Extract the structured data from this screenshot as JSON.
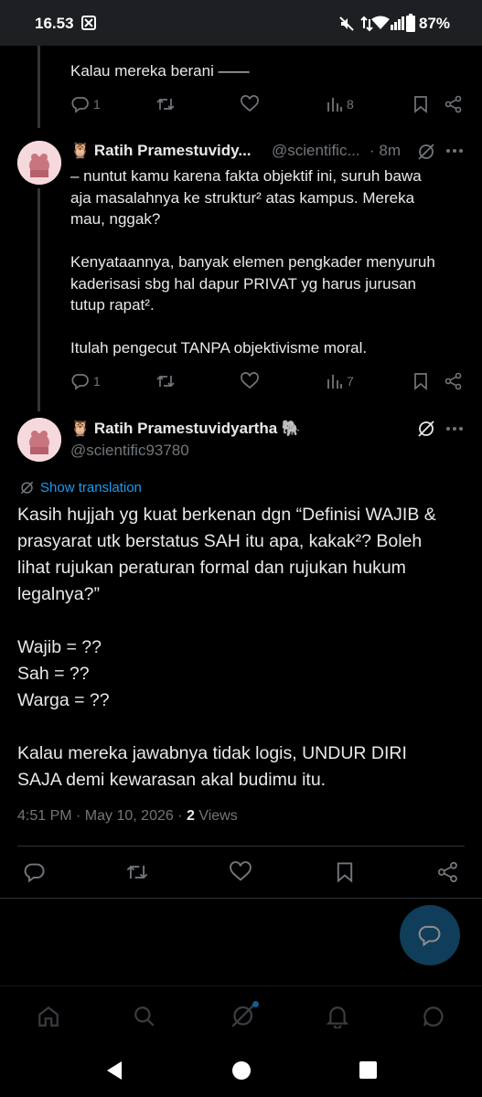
{
  "status_bar": {
    "time": "16.53",
    "battery": "87%"
  },
  "tweet1": {
    "text": "Kalau mereka berani ——",
    "replies": "1",
    "views": "8"
  },
  "tweet2": {
    "name": "🦉 Ratih Pramestuvidy...",
    "handle": "@scientific...",
    "time": "· 8m",
    "lines": [
      "– nuntut kamu karena fakta objektif ini, suruh bawa",
      "aja masalahnya ke struktur² atas kampus. Mereka",
      "mau, nggak?",
      "",
      "Kenyataannya, banyak elemen pengkader menyuruh",
      "kaderisasi sbg hal dapur PRIVAT yg harus jurusan",
      "tutup rapat².",
      "",
      "Itulah pengecut TANPA objektivisme moral."
    ],
    "replies": "1",
    "views": "7"
  },
  "main_tweet": {
    "name": "🦉 Ratih Pramestuvidyartha 🐘",
    "handle": "@scientific93780",
    "show_translation": "Show translation",
    "lines": [
      "Kasih hujjah yg kuat berkenan dgn “Definisi WAJIB &",
      "prasyarat utk berstatus SAH itu apa, kakak²? Boleh",
      "lihat rujukan peraturan formal dan rujukan hukum",
      "legalnya?”",
      "",
      "Wajib = ??",
      "Sah = ??",
      "Warga = ??",
      "",
      "Kalau mereka jawabnya tidak logis, UNDUR DIRI",
      "SAJA demi kewarasan akal budimu itu."
    ],
    "timestamp": "4:51 PM · May 10, 2026 · ",
    "views_count": "2",
    "views_label": " Views"
  },
  "colors": {
    "accent": "#1d9bf0",
    "muted": "#71767b",
    "text": "#e7e9ea"
  }
}
